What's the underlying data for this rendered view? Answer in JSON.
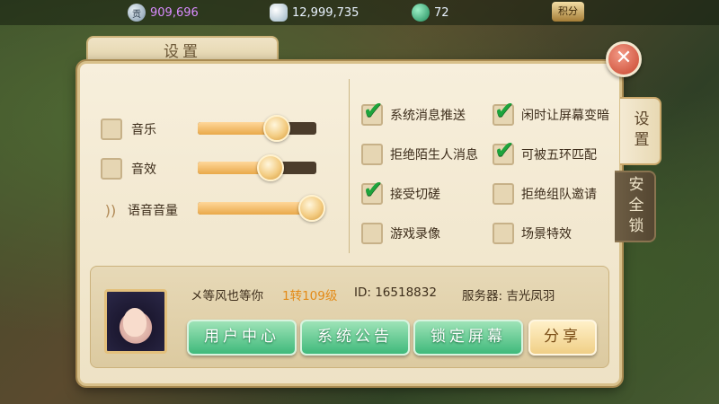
{
  "currency": {
    "gold": "909,696",
    "silver": "12,999,735",
    "jade": "72",
    "jifen_label": "积分",
    "gold_icon_glyph": "贡"
  },
  "dialog": {
    "title": "设置",
    "close_glyph": "✕",
    "tabs": [
      {
        "label": "设置",
        "active": true
      },
      {
        "label": "安全锁",
        "active": false
      }
    ]
  },
  "audio": [
    {
      "label": "音乐",
      "checked": false,
      "level": 0.65
    },
    {
      "label": "音效",
      "checked": false,
      "level": 0.6
    },
    {
      "label": "语音音量",
      "checked": null,
      "level": 0.95,
      "icon": "speaker-icon"
    }
  ],
  "options": [
    {
      "label": "系统消息推送",
      "checked": true
    },
    {
      "label": "闲时让屏幕变暗",
      "checked": true
    },
    {
      "label": "拒绝陌生人消息",
      "checked": false
    },
    {
      "label": "可被五环匹配",
      "checked": true
    },
    {
      "label": "接受切磋",
      "checked": true
    },
    {
      "label": "拒绝组队邀请",
      "checked": false
    },
    {
      "label": "游戏录像",
      "checked": false
    },
    {
      "label": "场景特效",
      "checked": false
    }
  ],
  "player": {
    "name": "メ等风也等你",
    "level": "1转109级",
    "id": "ID: 16518832",
    "server": "服务器:  吉光凤羽"
  },
  "buttons": {
    "user_center": "用户中心",
    "announcement": "系统公告",
    "lock_screen": "锁定屏幕",
    "share": "分享"
  },
  "colors": {
    "panel_bg": "#f7efdc",
    "check_green": "#1da43c",
    "slider_fill": "#e9a94a",
    "button_green": "#3fb97b",
    "level_orange": "#e38a17"
  }
}
